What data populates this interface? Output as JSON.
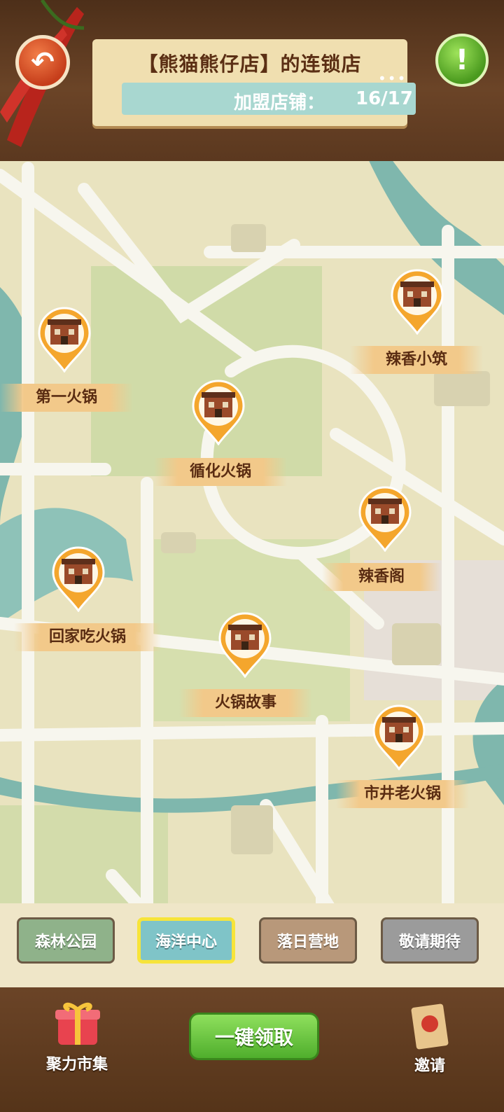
{
  "header": {
    "title": "【熊猫熊仔店】的连锁店",
    "franchise_label": "加盟店铺：",
    "franchise_count": "16/17",
    "back_icon": "undo-arrow-icon",
    "help_icon": "exclamation-icon",
    "menu_dots": "•••"
  },
  "stores": [
    {
      "name": "辣香小筑"
    },
    {
      "name": "第一火锅"
    },
    {
      "name": "循化火锅"
    },
    {
      "name": "辣香阁"
    },
    {
      "name": "回家吃火锅"
    },
    {
      "name": "火锅故事"
    },
    {
      "name": "市井老火锅"
    }
  ],
  "tabs": [
    {
      "label": "森林公园"
    },
    {
      "label": "海洋中心",
      "selected": true
    },
    {
      "label": "落日营地"
    },
    {
      "label": "敬请期待"
    }
  ],
  "bottom": {
    "market_label": "聚力市集",
    "claim_label": "一键领取",
    "invite_label": "邀请"
  },
  "colors": {
    "map_base": "#e9e3bf",
    "road": "#f7f6ee",
    "water": "#7fb7ad",
    "park": "#cdd9a5",
    "pin_orange": "#f4a62d",
    "claim_green": "#5fbe35"
  }
}
